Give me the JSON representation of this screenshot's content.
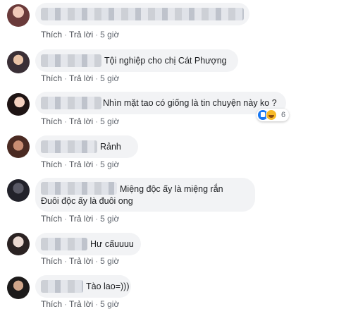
{
  "action_labels": {
    "like": "Thích",
    "reply": "Trả lời",
    "sep": "·"
  },
  "colors": {
    "bubble": "#f2f3f5",
    "link": "#4b4f56",
    "like_blue": "#1877f2",
    "haha_yellow": "#f7b928"
  },
  "comments": [
    {
      "text": "",
      "time": "5 giờ"
    },
    {
      "text": "Tội nghiệp cho chị Cát Phượng",
      "time": "5 giờ"
    },
    {
      "text": "Nhìn mặt tao có giống là tin chuyện này ko ?",
      "time": "5 giờ",
      "reactions": {
        "icons": [
          "like-icon",
          "haha-icon"
        ],
        "count": "6"
      }
    },
    {
      "text": "Rảnh",
      "time": "5 giờ"
    },
    {
      "text_line1": "Miệng độc ấy là miệng rắn",
      "text_line2": "Đuôi độc ấy là đuôi ong",
      "time": "5 giờ"
    },
    {
      "text": "Hư cấuuuu",
      "time": "5 giờ"
    },
    {
      "text": "Tào lao=)))",
      "time": "5 giờ"
    }
  ]
}
